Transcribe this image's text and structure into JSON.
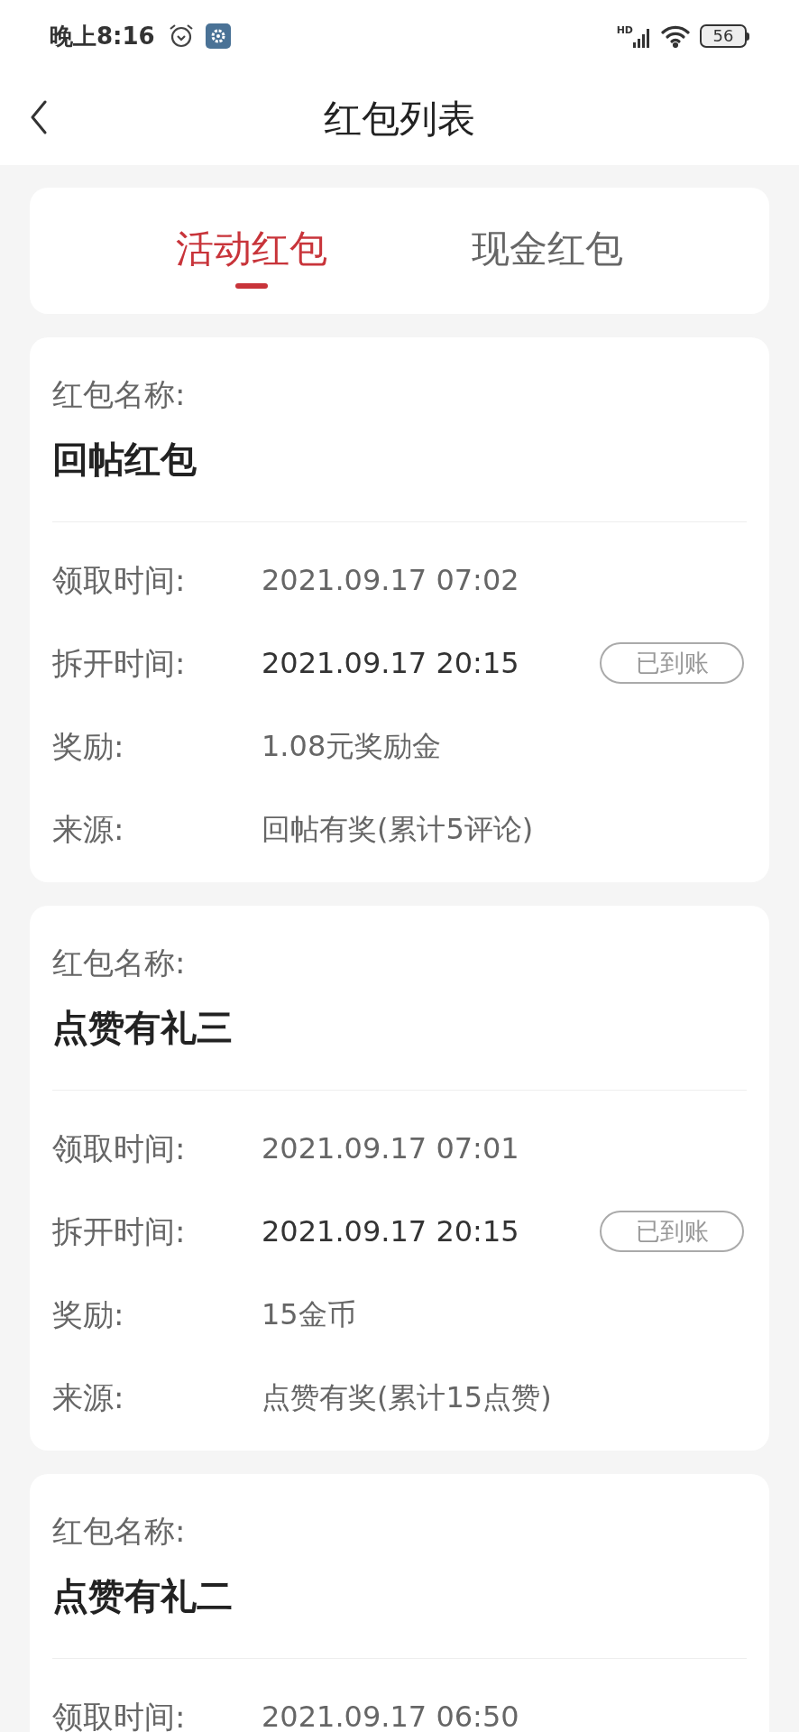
{
  "status_bar": {
    "time": "晚上8:16",
    "network_label": "HD",
    "battery": "56"
  },
  "header": {
    "title": "红包列表"
  },
  "tabs": [
    {
      "label": "活动红包",
      "selected": true
    },
    {
      "label": "现金红包",
      "selected": false
    }
  ],
  "cards": [
    {
      "name_label": "红包名称:",
      "name": "回帖红包",
      "rows": [
        {
          "label": "领取时间:",
          "value": "2021.09.17 07:02",
          "emphasis": false
        },
        {
          "label": "拆开时间:",
          "value": "2021.09.17 20:15",
          "emphasis": true,
          "badge": "已到账"
        },
        {
          "label": "奖励:",
          "value": "1.08元奖励金",
          "emphasis": false
        },
        {
          "label": "来源:",
          "value": "回帖有奖(累计5评论)",
          "emphasis": false
        }
      ]
    },
    {
      "name_label": "红包名称:",
      "name": "点赞有礼三",
      "rows": [
        {
          "label": "领取时间:",
          "value": "2021.09.17 07:01",
          "emphasis": false
        },
        {
          "label": "拆开时间:",
          "value": "2021.09.17 20:15",
          "emphasis": true,
          "badge": "已到账"
        },
        {
          "label": "奖励:",
          "value": "15金币",
          "emphasis": false
        },
        {
          "label": "来源:",
          "value": "点赞有奖(累计15点赞)",
          "emphasis": false
        }
      ]
    },
    {
      "name_label": "红包名称:",
      "name": "点赞有礼二",
      "rows": [
        {
          "label": "领取时间:",
          "value": "2021.09.17 06:50",
          "emphasis": false
        }
      ]
    }
  ]
}
